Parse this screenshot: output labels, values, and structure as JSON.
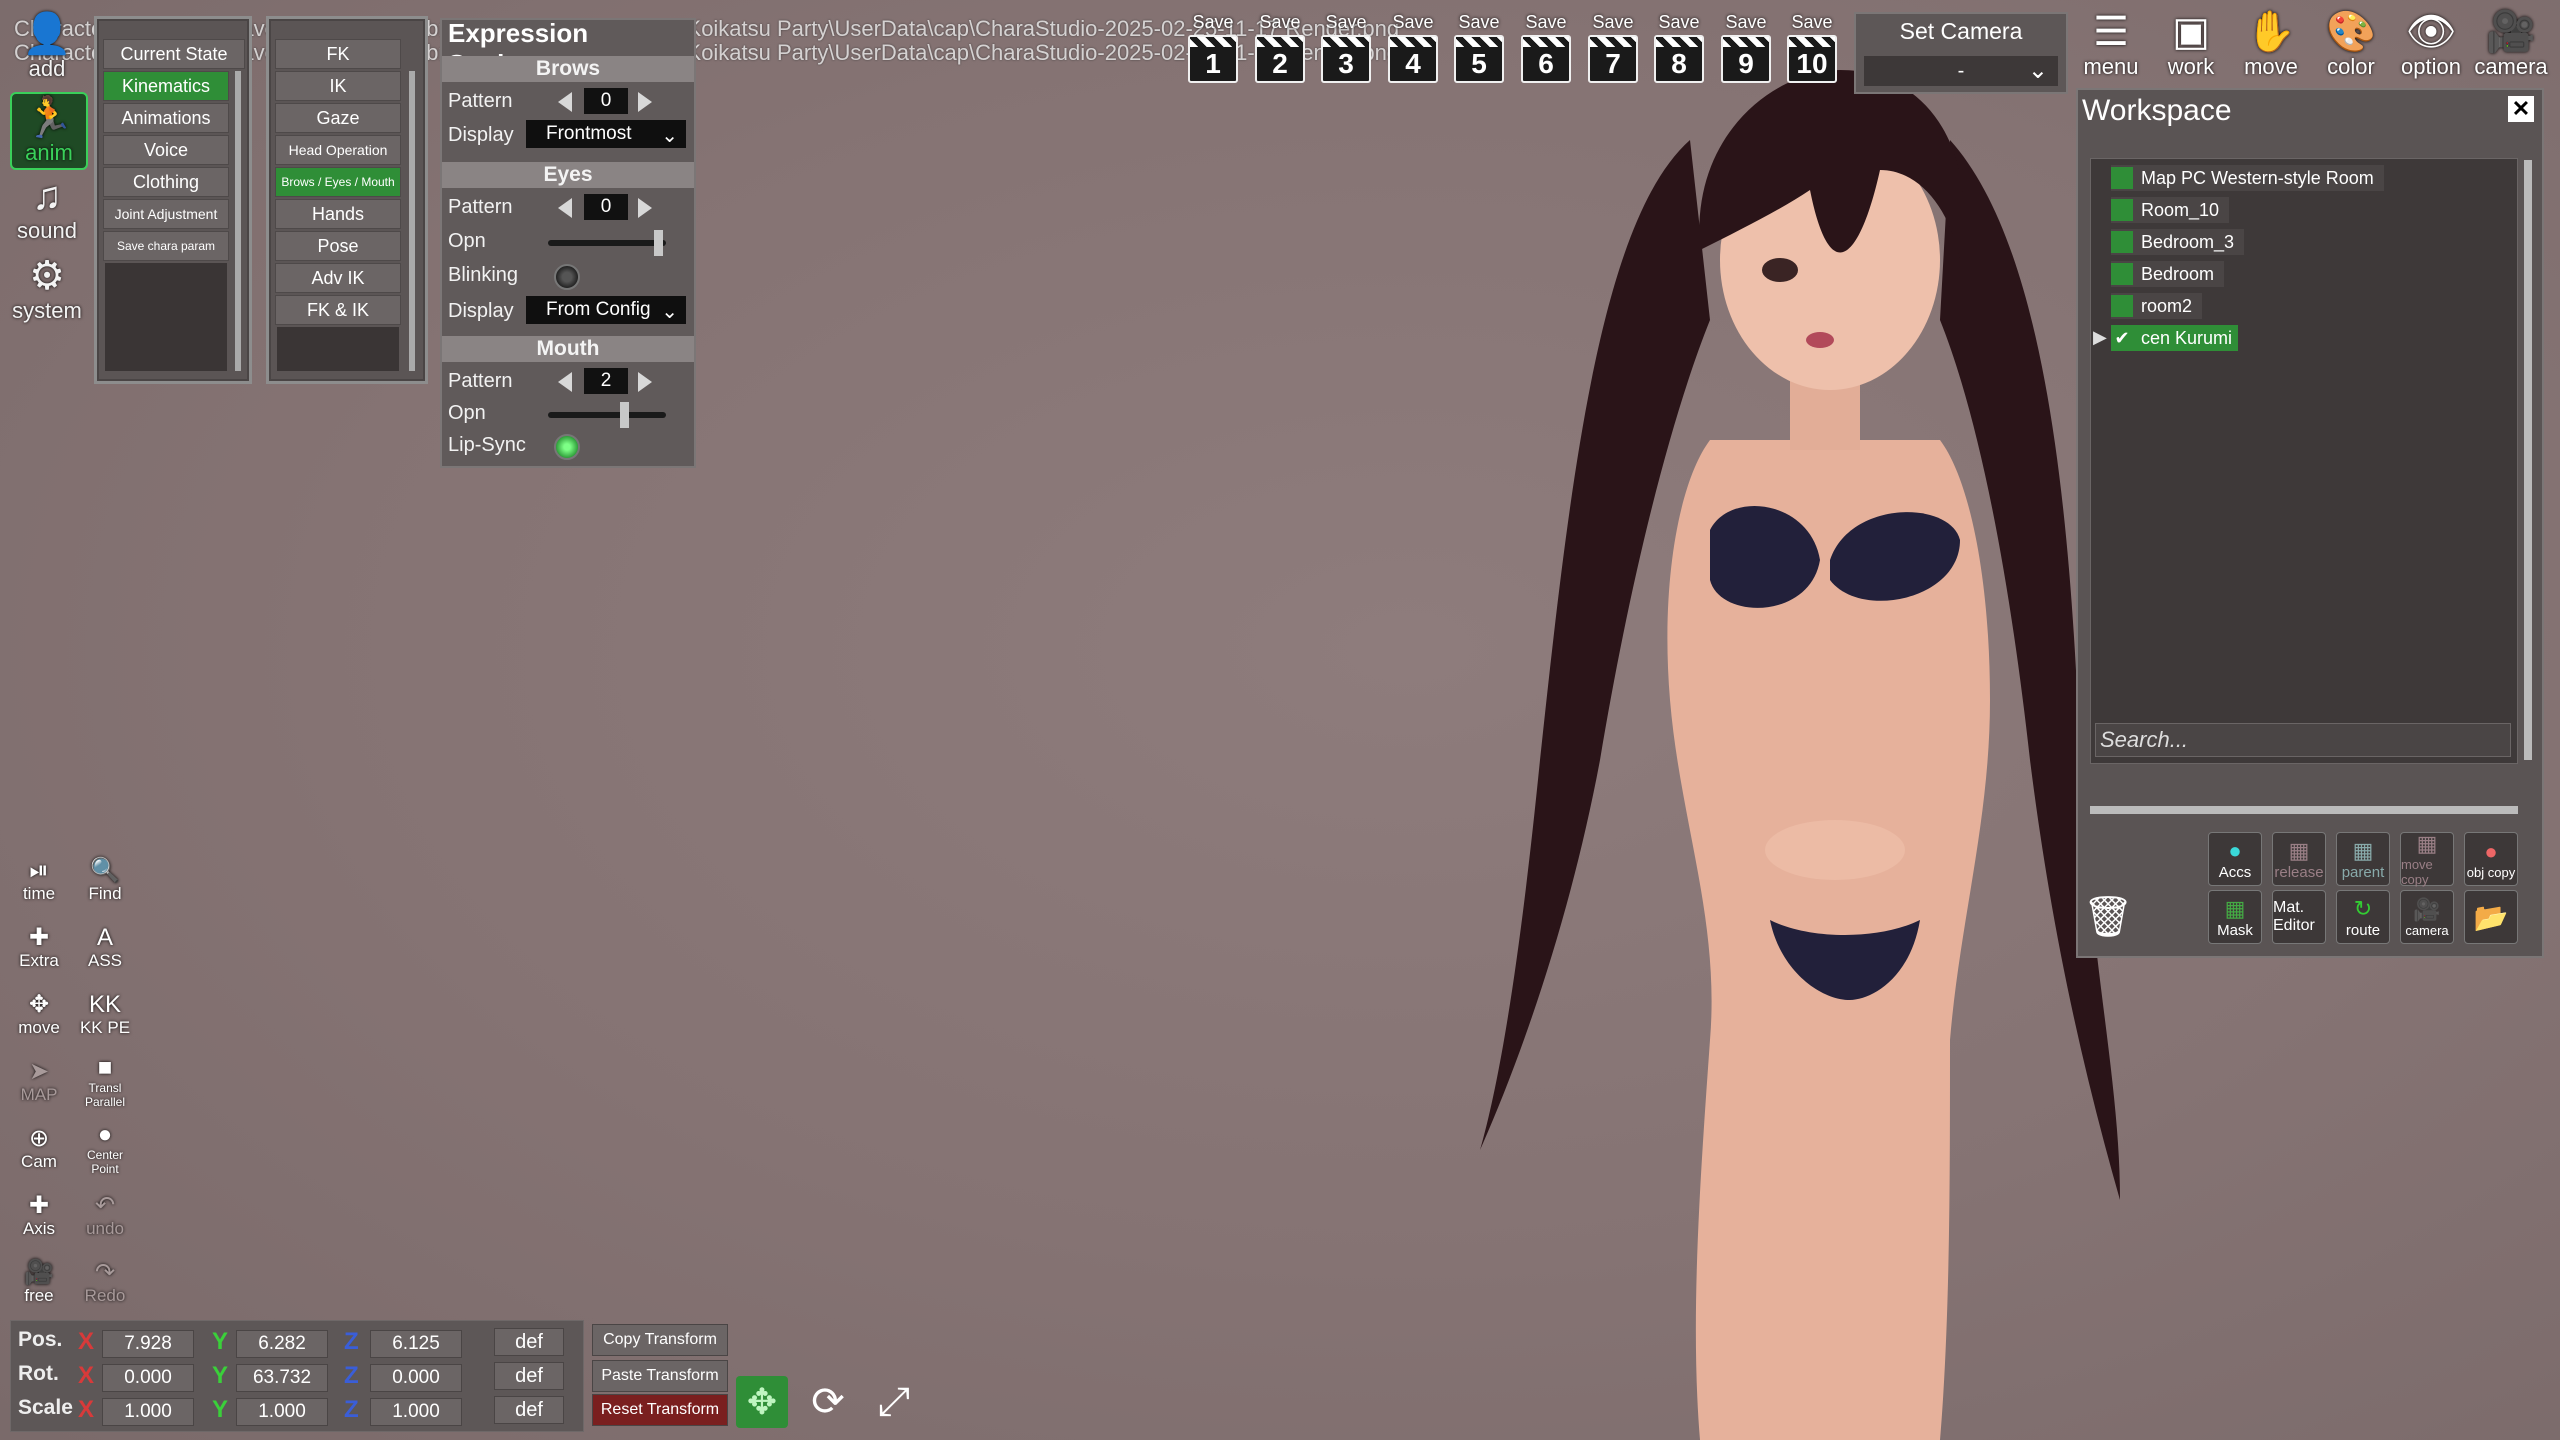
{
  "notifications": [
    "Character screenshot saved to F:\\SteamLibrary\\steamapps\\common\\Koikatsu Party\\UserData\\cap\\CharaStudio-2025-02-25-11-17 Render.png",
    "Character screenshot saved to F:\\SteamLibrary\\steamapps\\common\\Koikatsu Party\\UserData\\cap\\CharaStudio-2025-02-25-11-17 Render.png"
  ],
  "left_tools": [
    {
      "label": "add",
      "icon": "person-add-icon"
    },
    {
      "label": "anim",
      "icon": "running-figure-icon"
    },
    {
      "label": "sound",
      "icon": "music-note-icon"
    },
    {
      "label": "system",
      "icon": "gears-icon"
    }
  ],
  "menu1": {
    "title": "Current State",
    "items": [
      "Kinematics",
      "Animations",
      "Voice",
      "Clothing",
      "Joint Adjustment",
      "Save chara param"
    ],
    "selected": "Kinematics"
  },
  "menu2": {
    "title": "FK",
    "items": [
      "IK",
      "Gaze",
      "Head Operation",
      "Brows / Eyes / Mouth",
      "Hands",
      "Pose",
      "Adv IK",
      "FK & IK"
    ],
    "selected": "Brows / Eyes / Mouth"
  },
  "expression": {
    "title": "Expression Settings",
    "brows": {
      "header": "Brows",
      "pattern_label": "Pattern",
      "pattern": "0",
      "display_label": "Display",
      "display": "Frontmost"
    },
    "eyes": {
      "header": "Eyes",
      "pattern_label": "Pattern",
      "pattern": "0",
      "opn_label": "Opn",
      "opn": 1.0,
      "blinking_label": "Blinking",
      "blinking": false,
      "display_label": "Display",
      "display": "From Config"
    },
    "mouth": {
      "header": "Mouth",
      "pattern_label": "Pattern",
      "pattern": "2",
      "opn_label": "Opn",
      "opn": 0.68,
      "lipsync_label": "Lip-Sync",
      "lipsync": true
    }
  },
  "save_slots": {
    "label": "Save",
    "numbers": [
      "1",
      "2",
      "3",
      "4",
      "5",
      "6",
      "7",
      "8",
      "9",
      "10"
    ]
  },
  "set_camera": {
    "title": "Set Camera",
    "value": "-"
  },
  "right_tools": [
    {
      "label": "menu",
      "icon": "menu-icon"
    },
    {
      "label": "work",
      "icon": "window-icon"
    },
    {
      "label": "move",
      "icon": "hand-icon"
    },
    {
      "label": "color",
      "icon": "palette-icon"
    },
    {
      "label": "option",
      "icon": "eye-icon"
    },
    {
      "label": "camera",
      "icon": "camera-icon"
    }
  ],
  "workspace": {
    "title": "Workspace",
    "items": [
      "Map PC Western-style Room",
      "Room_10",
      "Bedroom_3",
      "Bedroom",
      "room2",
      "cen Kurumi"
    ],
    "selected": "cen Kurumi",
    "search_placeholder": "Search...",
    "buttons_row1": [
      "Accs",
      "release",
      "parent",
      "move copy",
      "obj copy"
    ],
    "buttons_row2": [
      "Mask",
      "Mat. Editor",
      "route",
      "camera",
      "folder"
    ]
  },
  "bottom_tools": [
    [
      "time",
      "Find"
    ],
    [
      "Extra",
      "ASS"
    ],
    [
      "move",
      "KK PE"
    ],
    [
      "MAP",
      "Transl Parallel"
    ],
    [
      "Cam",
      "Center Point"
    ],
    [
      "Axis",
      "undo"
    ],
    [
      "free",
      "Redo"
    ]
  ],
  "transform": {
    "pos_label": "Pos.",
    "rot_label": "Rot.",
    "scale_label": "Scale",
    "axis_labels": [
      "X",
      "Y",
      "Z"
    ],
    "pos": [
      "7.928",
      "6.282",
      "6.125"
    ],
    "rot": [
      "0.000",
      "63.732",
      "0.000"
    ],
    "scale": [
      "1.000",
      "1.000",
      "1.000"
    ],
    "def_label": "def",
    "copy_label": "Copy Transform",
    "paste_label": "Paste Transform",
    "reset_label": "Reset Transform"
  },
  "colors": {
    "accent_green": "#2f8e37",
    "panel_bg": "#5b5555",
    "reset_red": "#7a1f1f"
  }
}
